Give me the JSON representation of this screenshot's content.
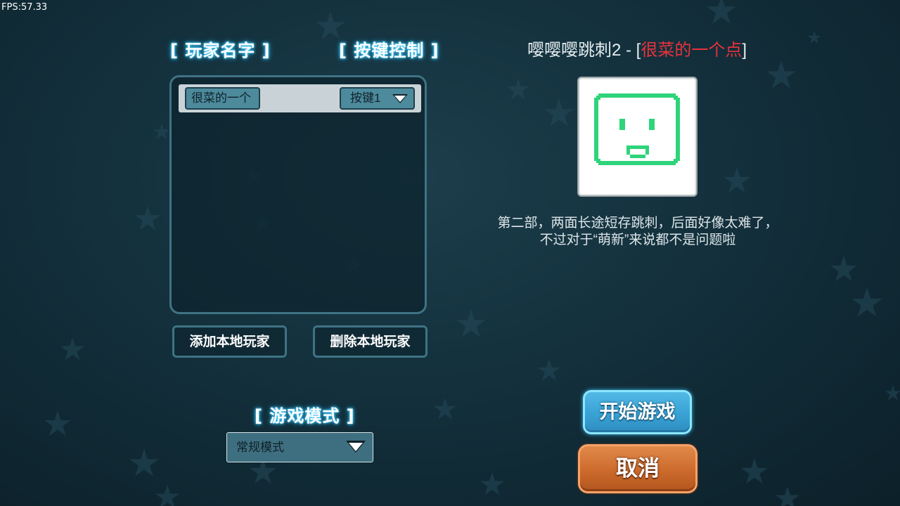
{
  "hud": {
    "fps": "FPS:57.33"
  },
  "players": {
    "header_name": "[ 玩家名字 ]",
    "header_keys": "[ 按键控制 ]",
    "rows": [
      {
        "name": "很菜的一个",
        "key": "按键1"
      }
    ],
    "add_button": "添加本地玩家",
    "remove_button": "删除本地玩家"
  },
  "mode": {
    "header": "[ 游戏模式 ]",
    "selected": "常规模式"
  },
  "map": {
    "title": "嘤嘤嘤跳刺2 - [",
    "author": "很菜的一个点",
    "title_close": "]",
    "description": "第二部，两面长途短存跳刺，后面好像太难了，不过对于“萌新”来说都不是问题啦",
    "author_color": "#e8323c",
    "preview_color": "#2ed47a"
  },
  "actions": {
    "start": "开始游戏",
    "cancel": "取消"
  },
  "icons": {
    "dropdown": "chevron-down-icon",
    "preview": "smiley-block-icon"
  }
}
